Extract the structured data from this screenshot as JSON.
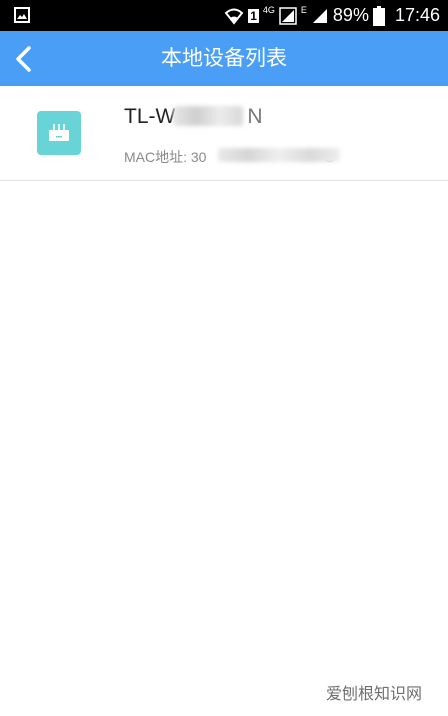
{
  "status_bar": {
    "network": "4G",
    "data_indicator": "E",
    "sim_badge": "1",
    "battery": "89%",
    "time": "17:46"
  },
  "nav": {
    "title": "本地设备列表"
  },
  "devices": [
    {
      "name": "TL-W",
      "name_suffix": "N",
      "mac_label": "MAC地址:",
      "mac_prefix": "30",
      "mac_suffix": "C"
    }
  ],
  "watermark": "爱刨根知识网",
  "colors": {
    "nav_bar": "#4a9ef5",
    "device_icon": "#69d4d7"
  }
}
